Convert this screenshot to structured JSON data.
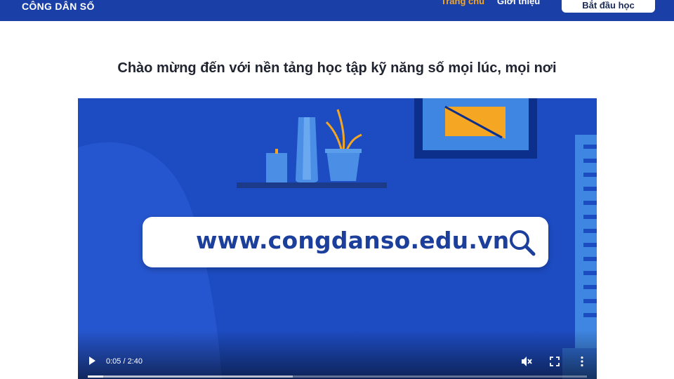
{
  "header": {
    "brand": "CÔNG DÂN SỐ",
    "nav": [
      {
        "label": "Trang chủ",
        "active": true
      },
      {
        "label": "Giới thiệu",
        "active": false
      }
    ],
    "cta_label": "Bắt đầu học",
    "colors": {
      "bar": "#1a3fa6",
      "active": "#f5a623"
    }
  },
  "main": {
    "title": "Chào mừng đến với nền tảng học tập kỹ năng số mọi lúc, mọi nơi"
  },
  "video": {
    "url_text": "www.congdanso.edu.vn",
    "time_display": "0:05 / 2:40",
    "current_seconds": 5,
    "duration_seconds": 160,
    "buffered_fraction": 0.41,
    "muted": true,
    "icons": [
      "play-icon",
      "muted-speaker-icon",
      "fullscreen-icon",
      "more-vertical-icon",
      "search-icon"
    ]
  }
}
